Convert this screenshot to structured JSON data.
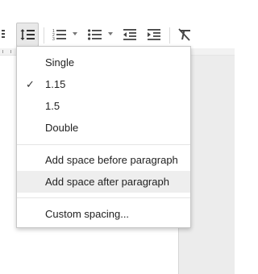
{
  "toolbar": {
    "buttons": [
      {
        "icon": "partial-align-icon"
      },
      {
        "icon": "line-spacing-icon",
        "active": true
      },
      {
        "icon": "numbered-list-icon"
      },
      {
        "icon": "bulleted-list-icon"
      },
      {
        "icon": "decrease-indent-icon"
      },
      {
        "icon": "increase-indent-icon"
      },
      {
        "icon": "clear-formatting-icon"
      }
    ]
  },
  "menu": {
    "items": [
      {
        "label": "Single",
        "checked": false
      },
      {
        "label": "1.15",
        "checked": true
      },
      {
        "label": "1.5",
        "checked": false
      },
      {
        "label": "Double",
        "checked": false
      }
    ],
    "paragraph_items": [
      {
        "label": "Add space before paragraph",
        "highlighted": false
      },
      {
        "label": "Add space after paragraph",
        "highlighted": true
      }
    ],
    "custom": {
      "label": "Custom spacing..."
    },
    "check_glyph": "✓"
  },
  "colors": {
    "menu_hover": "#eeeeee",
    "toolbar_active": "#e8e8e8",
    "icon": "#444444"
  }
}
